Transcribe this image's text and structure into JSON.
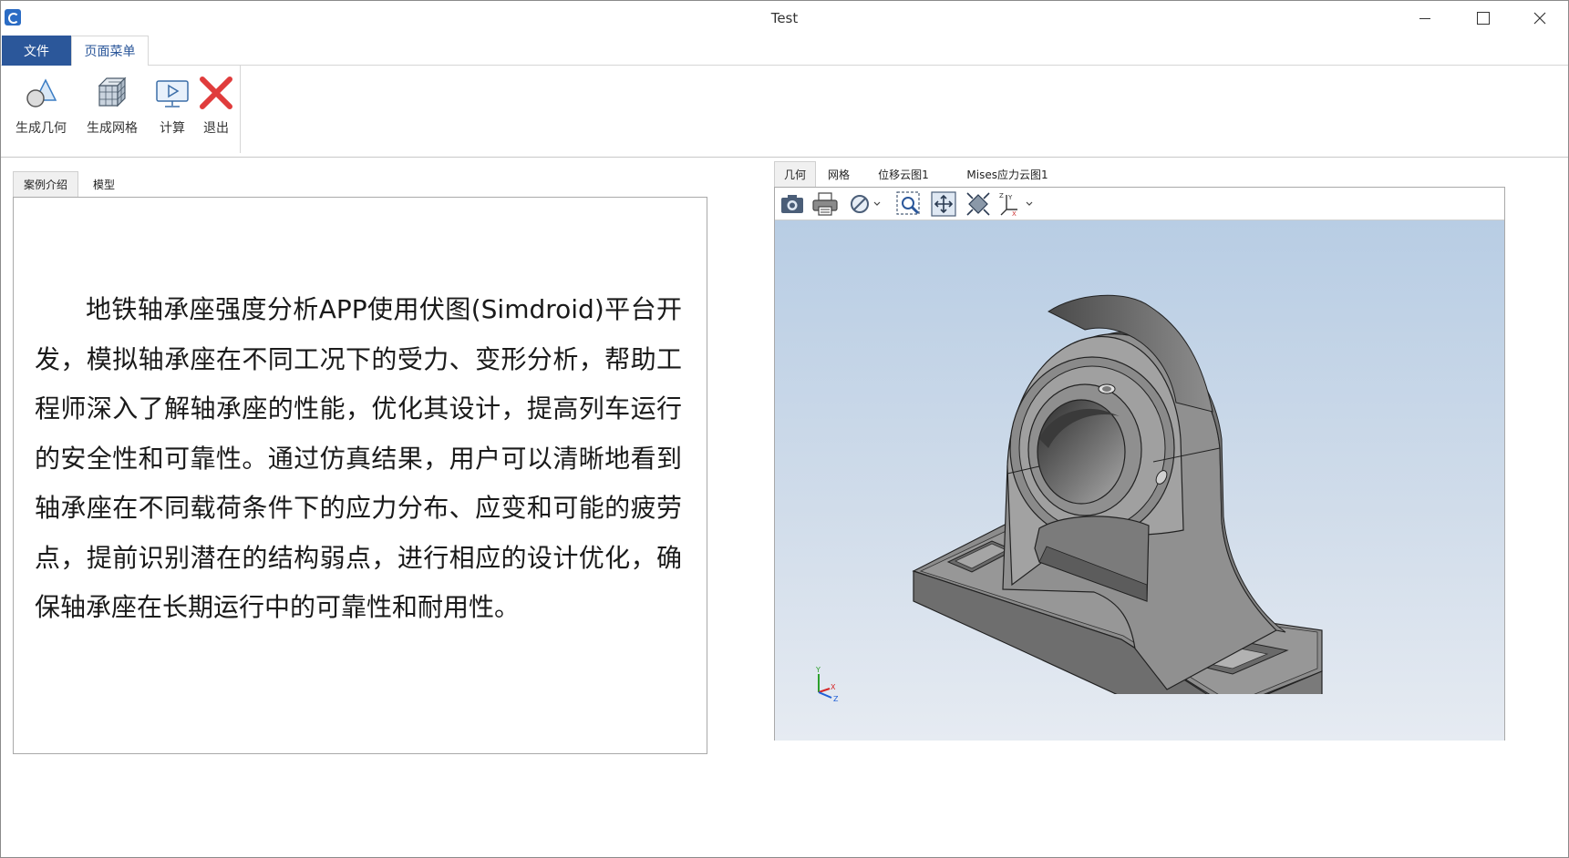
{
  "window": {
    "title": "Test"
  },
  "ribbon": {
    "tabs": [
      {
        "label": "文件",
        "active": false
      },
      {
        "label": "页面菜单",
        "active": true
      }
    ],
    "buttons": [
      {
        "label": "生成几何",
        "icon": "geometry-shapes-icon"
      },
      {
        "label": "生成网格",
        "icon": "mesh-cube-icon"
      },
      {
        "label": "计算",
        "icon": "compute-monitor-icon"
      },
      {
        "label": "退出",
        "icon": "exit-x-icon"
      }
    ]
  },
  "left_panel": {
    "tabs": [
      {
        "label": "案例介绍",
        "active": true
      },
      {
        "label": "模型",
        "active": false
      }
    ],
    "description": "地铁轴承座强度分析APP使用伏图(Simdroid)平台开发，模拟轴承座在不同工况下的受力、变形分析，帮助工程师深入了解轴承座的性能，优化其设计，提高列车运行的安全性和可靠性。通过仿真结果，用户可以清晰地看到轴承座在不同载荷条件下的应力分布、应变和可能的疲劳点，提前识别潜在的结构弱点，进行相应的设计优化，确保轴承座在长期运行中的可靠性和耐用性。"
  },
  "right_panel": {
    "tabs": [
      {
        "label": "几何",
        "active": true
      },
      {
        "label": "网格",
        "active": false
      },
      {
        "label": "位移云图1",
        "active": false
      },
      {
        "label": "Mises应力云图1",
        "active": false
      }
    ],
    "toolbar_icons": [
      "camera-icon",
      "print-icon",
      "display-mode-icon",
      "zoom-box-icon",
      "fit-view-icon",
      "iso-view-icon",
      "axis-orient-icon"
    ],
    "triad": {
      "x": "X",
      "y": "Y",
      "z": "Z"
    }
  },
  "colors": {
    "accent": "#2b579a",
    "viewport_top": "#b8cde4",
    "viewport_bottom": "#e6ebf2"
  }
}
